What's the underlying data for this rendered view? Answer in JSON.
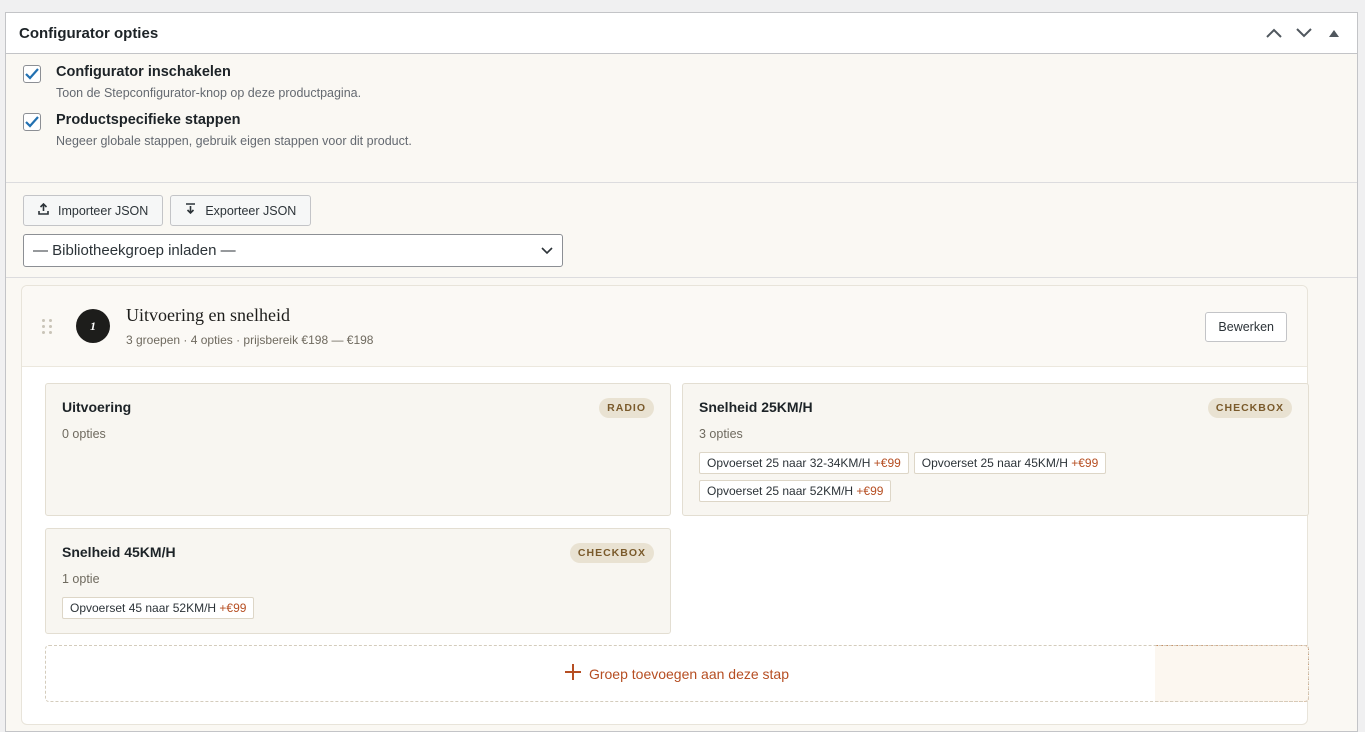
{
  "panel": {
    "title": "Configurator opties"
  },
  "options": [
    {
      "label": "Configurator inschakelen",
      "desc": "Toon de Stepconfigurator-knop op deze productpagina.",
      "checked": true
    },
    {
      "label": "Productspecifieke stappen",
      "desc": "Negeer globale stappen, gebruik eigen stappen voor dit product.",
      "checked": true
    }
  ],
  "tools": {
    "import_label": "Importeer JSON",
    "export_label": "Exporteer JSON",
    "library_select": "— Bibliotheekgroep inladen —"
  },
  "step": {
    "number": "1",
    "title": "Uitvoering en snelheid",
    "meta": "3 groepen · 4 opties · prijsbereik €198 — €198",
    "edit_label": "Bewerken",
    "groups": [
      {
        "title": "Uitvoering",
        "badge": "RADIO",
        "count": "0 opties",
        "chips": []
      },
      {
        "title": "Snelheid 25KM/H",
        "badge": "CHECKBOX",
        "count": "3 opties",
        "chips": [
          {
            "label": "Opvoerset 25 naar 32-34KM/H",
            "price": "+€99"
          },
          {
            "label": "Opvoerset 25 naar 45KM/H",
            "price": "+€99"
          },
          {
            "label": "Opvoerset 25 naar 52KM/H",
            "price": "+€99"
          }
        ]
      },
      {
        "title": "Snelheid 45KM/H",
        "badge": "CHECKBOX",
        "count": "1 optie",
        "chips": [
          {
            "label": "Opvoerset 45 naar 52KM/H",
            "price": "+€99"
          }
        ]
      }
    ],
    "add_group_label": "Groep toevoegen aan deze stap"
  },
  "colors": {
    "accent": "#b64e22",
    "checkbox": "#2271b1"
  }
}
